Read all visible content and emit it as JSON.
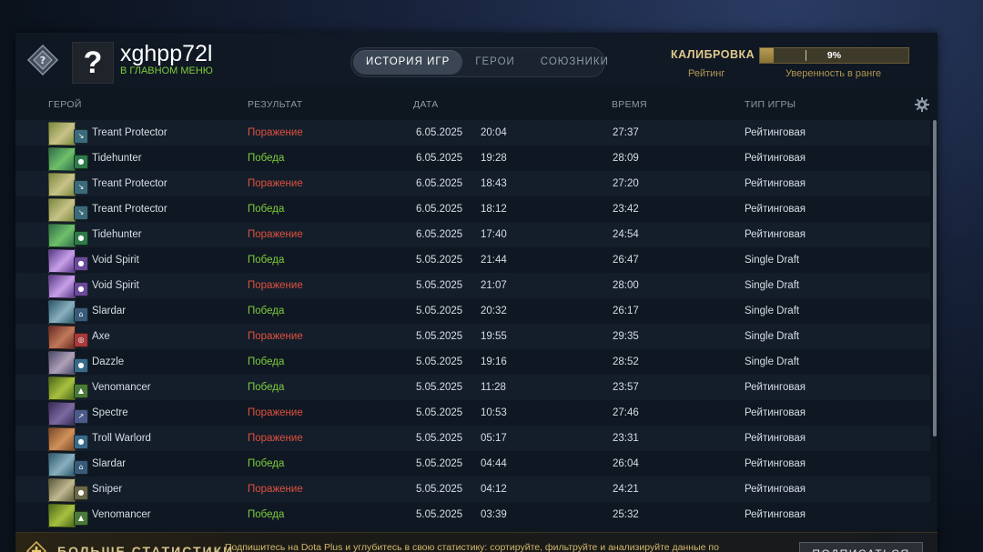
{
  "profile": {
    "username": "xghpp72l",
    "status": "В ГЛАВНОМ МЕНЮ",
    "avatar_glyph": "?"
  },
  "tabs": [
    {
      "label": "ИСТОРИЯ ИГР",
      "active": true
    },
    {
      "label": "ГЕРОИ",
      "active": false
    },
    {
      "label": "СОЮЗНИКИ",
      "active": false
    }
  ],
  "calibration": {
    "label": "КАЛИБРОВКА",
    "rating_label": "Рейтинг",
    "progress_percent": 9,
    "progress_text": "9%",
    "confidence_label": "Уверенность в ранге"
  },
  "columns": {
    "hero": "ГЕРОЙ",
    "result": "РЕЗУЛЬТАТ",
    "date": "ДАТА",
    "duration": "ВРЕМЯ",
    "mode": "ТИП ИГРЫ"
  },
  "matches": [
    {
      "hero": "Treant Protector",
      "result": "Поражение",
      "win": false,
      "date": "6.05.2025",
      "time": "20:04",
      "duration": "27:37",
      "mode": "Рейтинговая",
      "portrait": [
        "#7a8a3a",
        "#c8c28a"
      ],
      "role": "#3c6a7a",
      "role_glyph": "↘"
    },
    {
      "hero": "Tidehunter",
      "result": "Победа",
      "win": true,
      "date": "6.05.2025",
      "time": "19:28",
      "duration": "28:09",
      "mode": "Рейтинговая",
      "portrait": [
        "#2f6e4a",
        "#6fbf6a"
      ],
      "role": "#2f7a4a",
      "role_glyph": "●"
    },
    {
      "hero": "Treant Protector",
      "result": "Поражение",
      "win": false,
      "date": "6.05.2025",
      "time": "18:43",
      "duration": "27:20",
      "mode": "Рейтинговая",
      "portrait": [
        "#7a8a3a",
        "#c8c28a"
      ],
      "role": "#3c6a7a",
      "role_glyph": "↘"
    },
    {
      "hero": "Treant Protector",
      "result": "Победа",
      "win": true,
      "date": "6.05.2025",
      "time": "18:12",
      "duration": "23:42",
      "mode": "Рейтинговая",
      "portrait": [
        "#7a8a3a",
        "#c8c28a"
      ],
      "role": "#3c6a7a",
      "role_glyph": "↘"
    },
    {
      "hero": "Tidehunter",
      "result": "Поражение",
      "win": false,
      "date": "6.05.2025",
      "time": "17:40",
      "duration": "24:54",
      "mode": "Рейтинговая",
      "portrait": [
        "#2f6e4a",
        "#6fbf6a"
      ],
      "role": "#2f7a4a",
      "role_glyph": "●"
    },
    {
      "hero": "Void Spirit",
      "result": "Победа",
      "win": true,
      "date": "5.05.2025",
      "time": "21:44",
      "duration": "26:47",
      "mode": "Single Draft",
      "portrait": [
        "#5a3a8a",
        "#c8a0e8"
      ],
      "role": "#6a4a9a",
      "role_glyph": "●"
    },
    {
      "hero": "Void Spirit",
      "result": "Поражение",
      "win": false,
      "date": "5.05.2025",
      "time": "21:07",
      "duration": "28:00",
      "mode": "Single Draft",
      "portrait": [
        "#5a3a8a",
        "#c8a0e8"
      ],
      "role": "#6a4a9a",
      "role_glyph": "●"
    },
    {
      "hero": "Slardar",
      "result": "Победа",
      "win": true,
      "date": "5.05.2025",
      "time": "20:32",
      "duration": "26:17",
      "mode": "Single Draft",
      "portrait": [
        "#2a5a6a",
        "#8ab0c0"
      ],
      "role": "#3a5a7a",
      "role_glyph": "⌂"
    },
    {
      "hero": "Axe",
      "result": "Поражение",
      "win": false,
      "date": "5.05.2025",
      "time": "19:55",
      "duration": "29:35",
      "mode": "Single Draft",
      "portrait": [
        "#6a2a22",
        "#c07a5a"
      ],
      "role": "#a83a3a",
      "role_glyph": "◎"
    },
    {
      "hero": "Dazzle",
      "result": "Победа",
      "win": true,
      "date": "5.05.2025",
      "time": "19:16",
      "duration": "28:52",
      "mode": "Single Draft",
      "portrait": [
        "#4a4a6a",
        "#b0a0b8"
      ],
      "role": "#3a6a8a",
      "role_glyph": "●"
    },
    {
      "hero": "Venomancer",
      "result": "Победа",
      "win": true,
      "date": "5.05.2025",
      "time": "11:28",
      "duration": "23:57",
      "mode": "Рейтинговая",
      "portrait": [
        "#4a6a1a",
        "#a8c040"
      ],
      "role": "#4a7a3a",
      "role_glyph": "▲"
    },
    {
      "hero": "Spectre",
      "result": "Поражение",
      "win": false,
      "date": "5.05.2025",
      "time": "10:53",
      "duration": "27:46",
      "mode": "Рейтинговая",
      "portrait": [
        "#3a2a5a",
        "#7a6aa0"
      ],
      "role": "#4a5a8a",
      "role_glyph": "↗"
    },
    {
      "hero": "Troll Warlord",
      "result": "Поражение",
      "win": false,
      "date": "5.05.2025",
      "time": "05:17",
      "duration": "23:31",
      "mode": "Рейтинговая",
      "portrait": [
        "#7a4a2a",
        "#d0905a"
      ],
      "role": "#3a6a8a",
      "role_glyph": "●"
    },
    {
      "hero": "Slardar",
      "result": "Победа",
      "win": true,
      "date": "5.05.2025",
      "time": "04:44",
      "duration": "26:04",
      "mode": "Рейтинговая",
      "portrait": [
        "#2a5a6a",
        "#8ab0c0"
      ],
      "role": "#3a5a7a",
      "role_glyph": "⌂"
    },
    {
      "hero": "Sniper",
      "result": "Поражение",
      "win": false,
      "date": "5.05.2025",
      "time": "04:12",
      "duration": "24:21",
      "mode": "Рейтинговая",
      "portrait": [
        "#5a5a3a",
        "#c0b890"
      ],
      "role": "#6a6a4a",
      "role_glyph": "●"
    },
    {
      "hero": "Venomancer",
      "result": "Победа",
      "win": true,
      "date": "5.05.2025",
      "time": "03:39",
      "duration": "25:32",
      "mode": "Рейтинговая",
      "portrait": [
        "#4a6a1a",
        "#a8c040"
      ],
      "role": "#4a7a3a",
      "role_glyph": "▲"
    }
  ],
  "footer": {
    "title": "БОЛЬШЕ СТАТИСТИКИ",
    "description": "Подпишитесь на Dota Plus и углубитесь в свою статистику: сортируйте, фильтруйте и анализируйте данные по",
    "subscribe_label": "ПОДПИСАТЬСЯ"
  },
  "colors": {
    "win": "#7ecb3c",
    "loss": "#e0503f",
    "gold": "#e0c88a"
  }
}
